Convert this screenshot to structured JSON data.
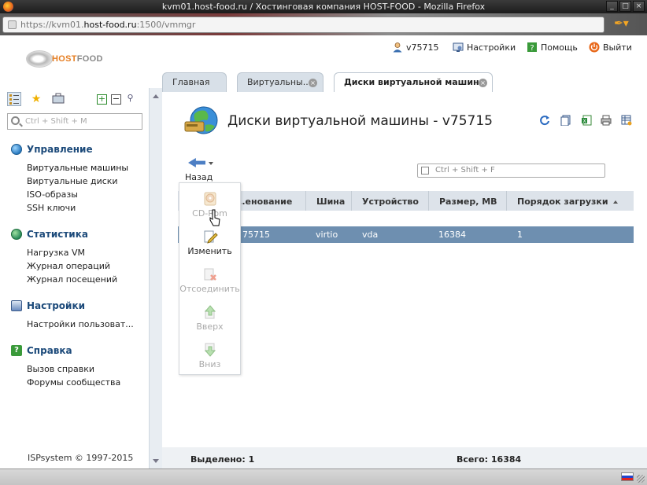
{
  "window": {
    "title": "kvm01.host-food.ru / Хостинговая компания HOST-FOOD - Mozilla Firefox",
    "url_prefix": "https://kvm01.",
    "url_host": "host-food.ru",
    "url_suffix": ":1500/vmmgr"
  },
  "header": {
    "logo_host": "HOST",
    "logo_food": "FOOD",
    "user": "v75715",
    "settings": "Настройки",
    "help": "Помощь",
    "logout": "Выйти"
  },
  "sidebar": {
    "search_placeholder": "Ctrl + Shift + M",
    "groups": [
      {
        "title": "Управление",
        "items": [
          "Виртуальные машины",
          "Виртуальные диски",
          "ISO-образы",
          "SSH ключи"
        ]
      },
      {
        "title": "Статистика",
        "items": [
          "Нагрузка VM",
          "Журнал операций",
          "Журнал посещений"
        ]
      },
      {
        "title": "Настройки",
        "items": [
          "Настройки пользоват..."
        ]
      },
      {
        "title": "Справка",
        "items": [
          "Вызов справки",
          "Форумы сообщества"
        ]
      }
    ],
    "footer": "ISPsystem © 1997-2015"
  },
  "tabs": [
    {
      "label": "Главная"
    },
    {
      "label": "Виртуальны..."
    },
    {
      "label": "Диски виртуальной машины ..."
    }
  ],
  "main": {
    "title": "Диски виртуальной машины - v75715",
    "back_label": "Назад",
    "filter_placeholder": "Ctrl + Shift + F",
    "columns": [
      "...енование",
      "Шина",
      "Устройство",
      "Размер, MB",
      "Порядок загрузки"
    ],
    "rows": [
      {
        "name": "75715",
        "bus": "virtio",
        "device": "vda",
        "size": "16384",
        "boot_order": "1"
      }
    ],
    "toolbar": [
      {
        "label": "CD-Rom",
        "enabled": false
      },
      {
        "label": "Изменить",
        "enabled": true
      },
      {
        "label": "Отсоединить",
        "enabled": false
      },
      {
        "label": "Вверх",
        "enabled": false
      },
      {
        "label": "Вниз",
        "enabled": false
      }
    ]
  },
  "status": {
    "selected": "Выделено: 1",
    "total": "Всего: 16384"
  },
  "colors": {
    "accent": "#1c4a7a",
    "selected_row": "#6e8fb0",
    "header_row": "#dde3ea",
    "logo_orange": "#e67e22"
  }
}
